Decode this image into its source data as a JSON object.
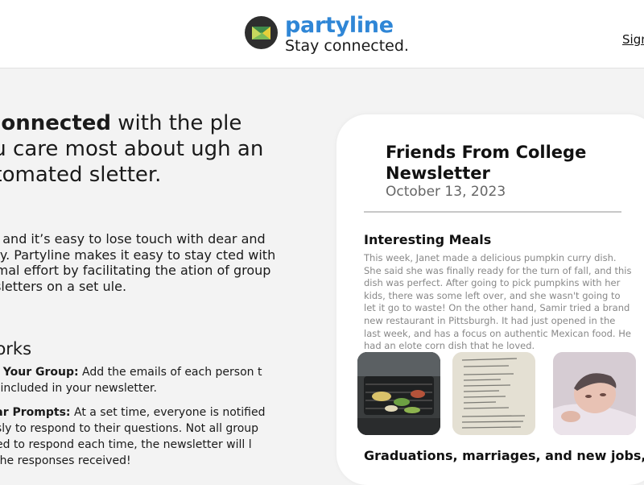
{
  "header": {
    "brand_name": "partyline",
    "tagline": "Stay connected.",
    "signin_label": "Sign"
  },
  "hero": {
    "headline_bold": "y connected",
    "headline_rest": " with the ple you care most about ugh an automated sletter.",
    "intro": "ectic and it’s easy to lose touch with dear and family. Partyline makes it easy to stay cted with minimal effort by facilitating the ation of group newsletters on a set ule."
  },
  "how_it_works": {
    "title": "t Works",
    "steps": [
      {
        "label": "mble Your Group:",
        "text": " Add the emails of each person t to be included in your newsletter."
      },
      {
        "label": "egular Prompts:",
        "text": " At a set time, everyone is notified neously to respond to their questions. Not all group rs need to respond each time, the newsletter will l with the responses received!"
      }
    ]
  },
  "newsletter": {
    "title": "Friends From College Newsletter",
    "date": "October 13, 2023",
    "section1_title": "Interesting Meals",
    "section1_body": "This week, Janet made a delicious pumpkin curry dish. She said she was finally ready for the turn of fall, and this dish was perfect. After going to pick pumpkins with her kids, there was some left over, and she wasn't going to let it go to waste! On the other hand, Samir tried a brand new restaurant in Pittsburgh. It had just opened in the last week, and has a focus on authentic Mexican food. He had an elote corn dish that he loved.",
    "section2_title": "Graduations, marriages, and new jobs,"
  },
  "colors": {
    "brand": "#2f86d6",
    "background": "#f3f3f3",
    "card": "#ffffff"
  }
}
